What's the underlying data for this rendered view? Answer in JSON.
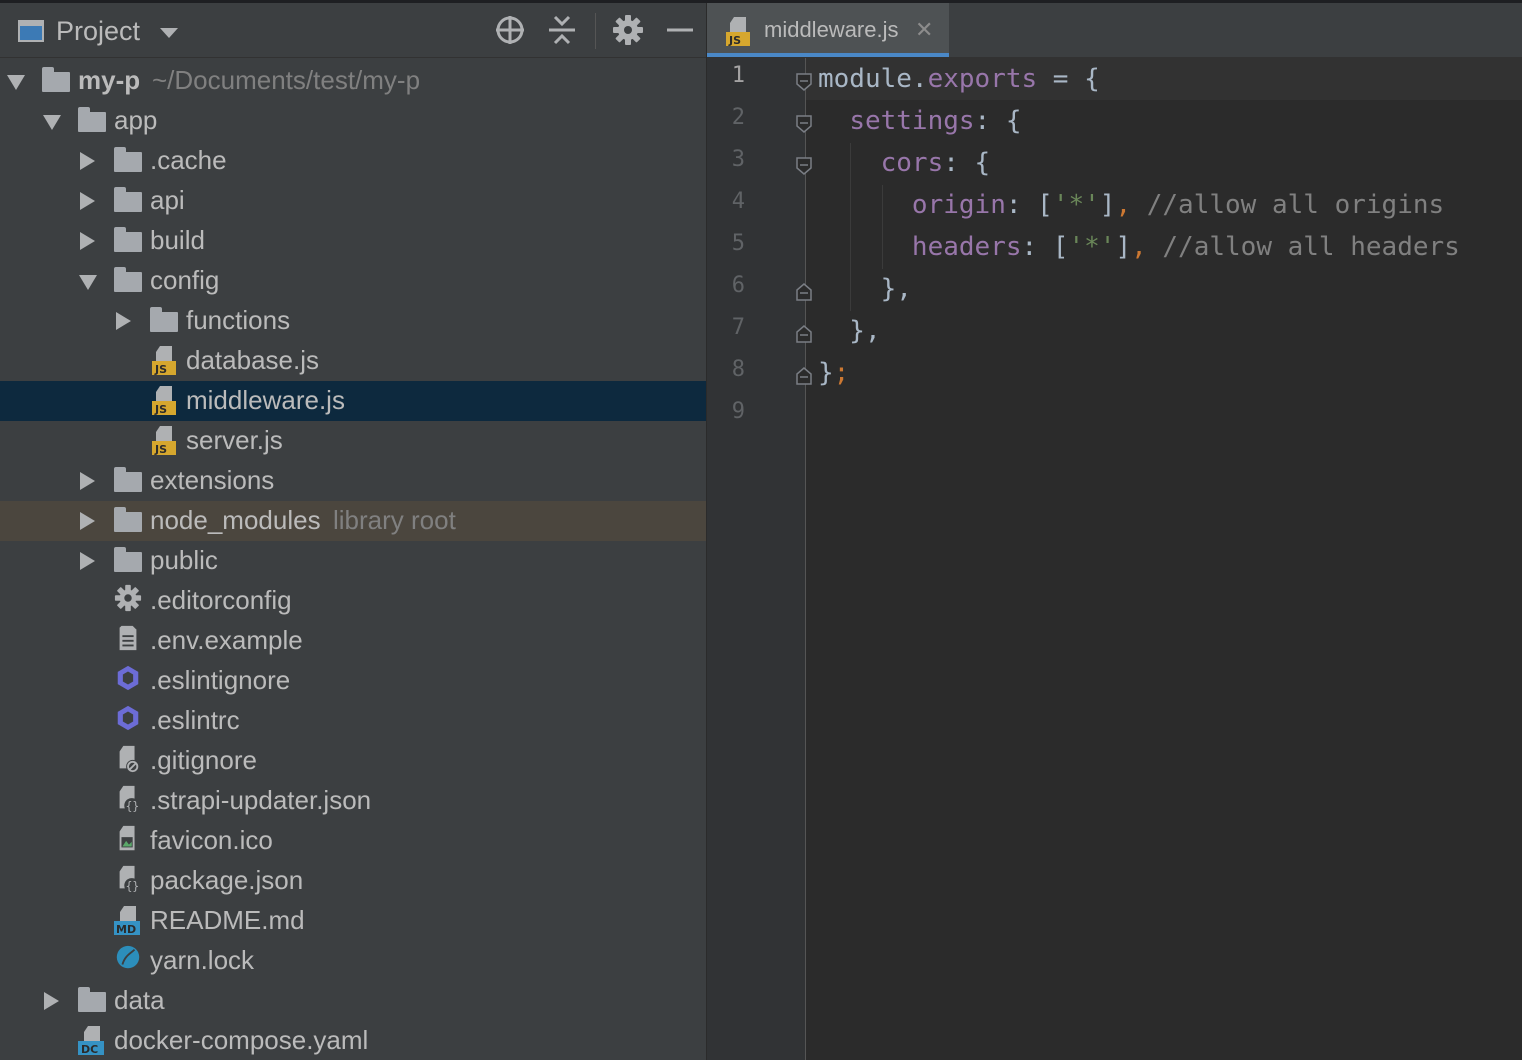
{
  "project_panel": {
    "title": "Project",
    "toolbar": {
      "locate_label": "",
      "collapse_label": "",
      "settings_label": "",
      "hide_label": ""
    },
    "tree": [
      {
        "label": "my-p",
        "hint": "~/Documents/test/my-p",
        "type": "folder",
        "state": "expanded",
        "depth": 0,
        "bold": true
      },
      {
        "label": "app",
        "type": "folder",
        "state": "expanded",
        "depth": 1
      },
      {
        "label": ".cache",
        "type": "folder",
        "state": "collapsed",
        "depth": 2
      },
      {
        "label": "api",
        "type": "folder",
        "state": "collapsed",
        "depth": 2
      },
      {
        "label": "build",
        "type": "folder",
        "state": "collapsed",
        "depth": 2
      },
      {
        "label": "config",
        "type": "folder",
        "state": "expanded",
        "depth": 2
      },
      {
        "label": "functions",
        "type": "folder",
        "state": "collapsed",
        "depth": 3
      },
      {
        "label": "database.js",
        "type": "js",
        "depth": 3
      },
      {
        "label": "middleware.js",
        "type": "js",
        "depth": 3,
        "selected": true
      },
      {
        "label": "server.js",
        "type": "js",
        "depth": 3
      },
      {
        "label": "extensions",
        "type": "folder",
        "state": "collapsed",
        "depth": 2
      },
      {
        "label": "node_modules",
        "hint": "library root",
        "type": "folder",
        "state": "collapsed",
        "depth": 2,
        "library": true
      },
      {
        "label": "public",
        "type": "folder",
        "state": "collapsed",
        "depth": 2
      },
      {
        "label": ".editorconfig",
        "type": "gear",
        "depth": 2
      },
      {
        "label": ".env.example",
        "type": "text",
        "depth": 2
      },
      {
        "label": ".eslintignore",
        "type": "eslint",
        "depth": 2
      },
      {
        "label": ".eslintrc",
        "type": "eslint",
        "depth": 2
      },
      {
        "label": ".gitignore",
        "type": "ignore",
        "depth": 2
      },
      {
        "label": ".strapi-updater.json",
        "type": "json",
        "depth": 2
      },
      {
        "label": "favicon.ico",
        "type": "image",
        "depth": 2
      },
      {
        "label": "package.json",
        "type": "json",
        "depth": 2
      },
      {
        "label": "README.md",
        "type": "md",
        "depth": 2
      },
      {
        "label": "yarn.lock",
        "type": "yarn",
        "depth": 2
      },
      {
        "label": "data",
        "type": "folder",
        "state": "collapsed",
        "depth": 1
      },
      {
        "label": "docker-compose.yaml",
        "type": "dc",
        "depth": 1
      }
    ]
  },
  "editor": {
    "tab": {
      "label": "middleware.js",
      "close": "✕",
      "icon": "js-file-icon"
    },
    "line_numbers": [
      "1",
      "2",
      "3",
      "4",
      "5",
      "6",
      "7",
      "8",
      "9"
    ],
    "lines": [
      [
        {
          "t": "module",
          "c": "k-id"
        },
        {
          "t": ".",
          "c": "k-id"
        },
        {
          "t": "exports",
          "c": "k-prop"
        },
        {
          "t": " = {",
          "c": "k-id"
        }
      ],
      [
        {
          "t": "  ",
          "c": "k-id"
        },
        {
          "t": "settings",
          "c": "k-prop"
        },
        {
          "t": ": {",
          "c": "k-id"
        }
      ],
      [
        {
          "t": "    ",
          "c": "k-id"
        },
        {
          "t": "cors",
          "c": "k-prop"
        },
        {
          "t": ": {",
          "c": "k-id"
        }
      ],
      [
        {
          "t": "      ",
          "c": "k-id"
        },
        {
          "t": "origin",
          "c": "k-prop"
        },
        {
          "t": ": [",
          "c": "k-id"
        },
        {
          "t": "'*'",
          "c": "k-str"
        },
        {
          "t": "]",
          "c": "k-id"
        },
        {
          "t": ",",
          "c": "k-punc"
        },
        {
          "t": " //allow all origins",
          "c": "k-com"
        }
      ],
      [
        {
          "t": "      ",
          "c": "k-id"
        },
        {
          "t": "headers",
          "c": "k-prop"
        },
        {
          "t": ": [",
          "c": "k-id"
        },
        {
          "t": "'*'",
          "c": "k-str"
        },
        {
          "t": "]",
          "c": "k-id"
        },
        {
          "t": ",",
          "c": "k-punc"
        },
        {
          "t": " //allow all headers",
          "c": "k-com"
        }
      ],
      [
        {
          "t": "    },",
          "c": "k-id"
        }
      ],
      [
        {
          "t": "  },",
          "c": "k-id"
        }
      ],
      [
        {
          "t": "}",
          "c": "k-id"
        },
        {
          "t": ";",
          "c": "k-punc"
        }
      ],
      []
    ]
  },
  "colors": {
    "panel_bg": "#3c3f41",
    "editor_bg": "#2b2b2b",
    "selection": "#0d293e",
    "library_highlight": "#4b463e",
    "tab_underline": "#4a88c7",
    "js_badge": "#d6a72e"
  }
}
